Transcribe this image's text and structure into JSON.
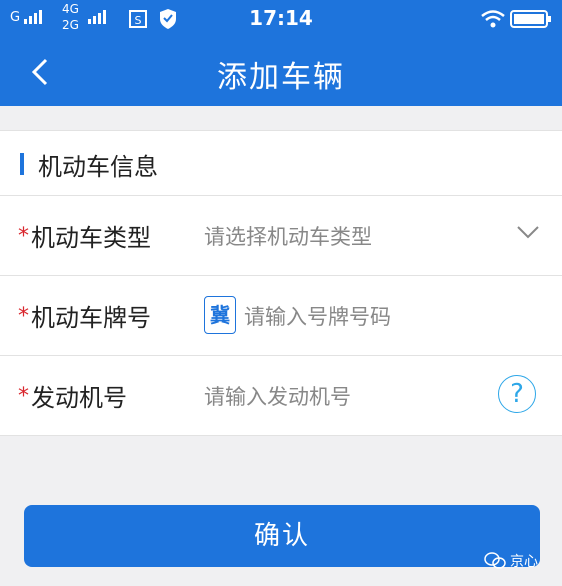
{
  "status_bar": {
    "carrier_g": "G",
    "network_4g": "4G",
    "network_2g": "2G",
    "time": "17:14",
    "icons": [
      "signal-bars-icon",
      "sim-card-icon",
      "vpn-shield-icon",
      "wifi-icon",
      "battery-icon"
    ]
  },
  "header": {
    "title": "添加车辆",
    "back_icon": "chevron-left-icon"
  },
  "section": {
    "title": "机动车信息"
  },
  "fields": [
    {
      "required_mark": "*",
      "label": "机动车类型",
      "placeholder": "请选择机动车类型",
      "trailing_icon": "chevron-down-icon"
    },
    {
      "required_mark": "*",
      "label": "机动车牌号",
      "prefix": "冀",
      "placeholder": "请输入号牌号码"
    },
    {
      "required_mark": "*",
      "label": "发动机号",
      "placeholder": "请输入发动机号",
      "trailing_icon": "help-circle-icon",
      "help_text": "?"
    }
  ],
  "confirm_button": {
    "label": "确认"
  },
  "watermark": {
    "text": "京心",
    "icon": "wechat-icon"
  },
  "colors": {
    "primary": "#1e74dc",
    "required": "#d9272e",
    "help": "#2ea7e8",
    "background": "#f0f0f2"
  }
}
